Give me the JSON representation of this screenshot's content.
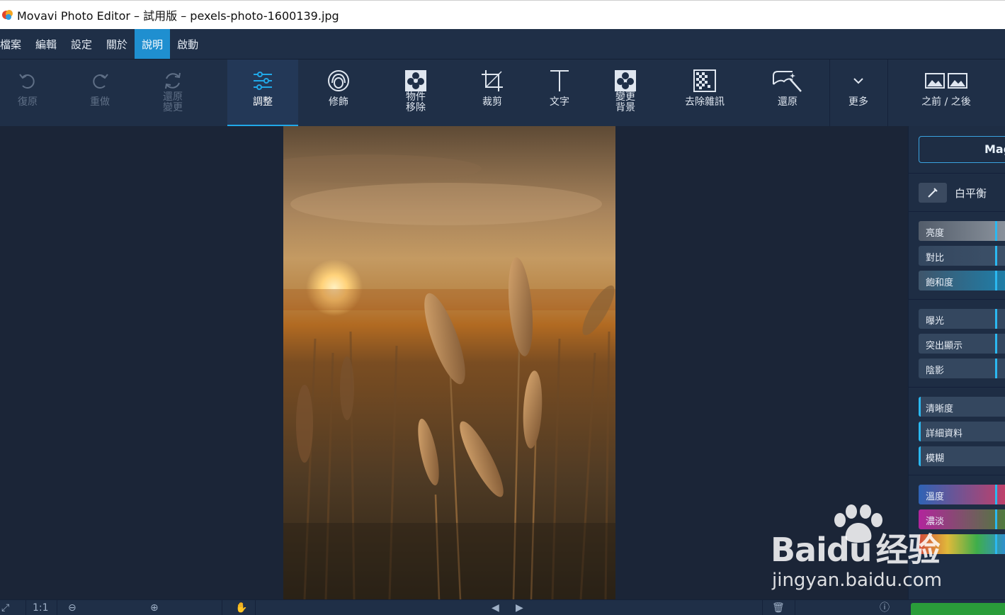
{
  "window": {
    "title": "Movavi Photo Editor – 試用版 – pexels-photo-1600139.jpg"
  },
  "menu": {
    "items": [
      {
        "label": "檔案",
        "active": false
      },
      {
        "label": "編輯",
        "active": false
      },
      {
        "label": "設定",
        "active": false
      },
      {
        "label": "關於",
        "active": false
      },
      {
        "label": "說明",
        "active": true
      },
      {
        "label": "啟動",
        "active": false
      }
    ]
  },
  "toolbar": {
    "undo": {
      "label": "復原",
      "icon": "undo-icon",
      "enabled": false
    },
    "redo": {
      "label": "重做",
      "icon": "redo-icon",
      "enabled": false
    },
    "revert": {
      "label": "還原\n變更",
      "icon": "revert-icon",
      "enabled": false
    },
    "adjust": {
      "label": "調整",
      "icon": "sliders-icon",
      "active": true
    },
    "retouch": {
      "label": "修飾",
      "icon": "face-icon"
    },
    "object_removal": {
      "label": "物件\n移除",
      "icon": "object-removal-icon"
    },
    "crop": {
      "label": "裁剪",
      "icon": "crop-icon"
    },
    "text": {
      "label": "文字",
      "icon": "text-icon"
    },
    "change_background": {
      "label": "變更\n背景",
      "icon": "background-icon"
    },
    "denoise": {
      "label": "去除雜訊",
      "icon": "noise-icon"
    },
    "restore": {
      "label": "還原",
      "icon": "restore-wand-icon"
    },
    "more": {
      "label": "更多",
      "icon": "chevron-down-icon"
    },
    "before_after": {
      "label": "之前 / 之後",
      "icon": "before-after-icon"
    }
  },
  "panel": {
    "magic_button": "Magic",
    "white_balance": {
      "label": "白平衡",
      "icon": "eyedropper-icon"
    },
    "group1": [
      {
        "label": "亮度",
        "value": 0.5
      },
      {
        "label": "對比",
        "value": 0.5
      },
      {
        "label": "飽和度",
        "value": 0.5
      }
    ],
    "group2": [
      {
        "label": "曝光",
        "value": 0.5
      },
      {
        "label": "突出顯示",
        "value": 0.5
      },
      {
        "label": "陰影",
        "value": 0.5
      }
    ],
    "group3": [
      {
        "label": "清晰度",
        "value": 0
      },
      {
        "label": "詳細資料",
        "value": 0
      },
      {
        "label": "模糊",
        "value": 0
      }
    ],
    "group4": [
      {
        "label": "溫度",
        "value": 0.5
      },
      {
        "label": "濃淡",
        "value": 0.5
      },
      {
        "label": "",
        "value": 0.5
      }
    ]
  },
  "watermark": {
    "brand_left": "Bai",
    "brand_right": "du",
    "brand_cn": "经验",
    "url": "jingyan.baidu.com"
  },
  "colors": {
    "accent": "#21a8e8",
    "menu_active": "#1f8fd0",
    "chrome": "#1f2f47",
    "workspace": "#1b2537",
    "save_green": "#2a9d3a"
  }
}
